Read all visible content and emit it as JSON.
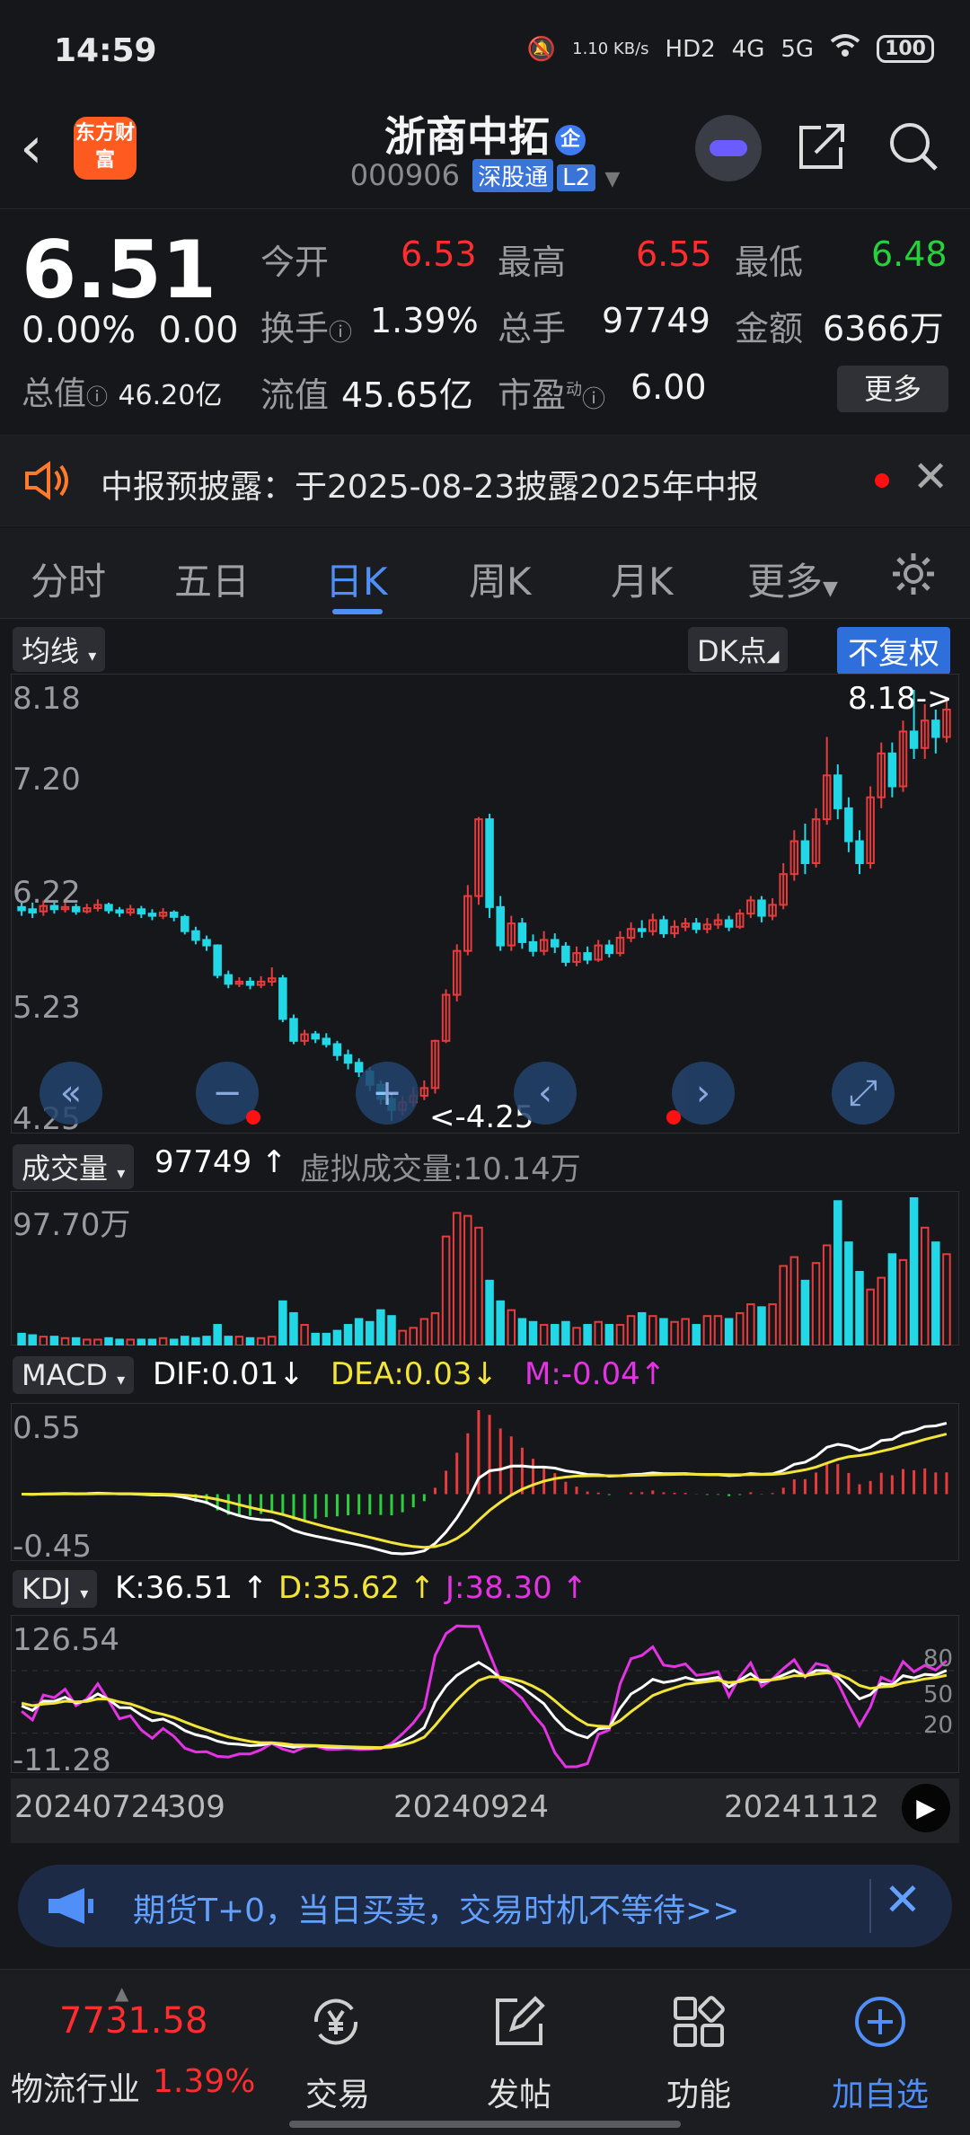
{
  "status": {
    "time": "14:59",
    "net_speed": "1.10 KB/s",
    "signal_a": "4G",
    "signal_b": "5G",
    "battery": "100",
    "hd": "HD2"
  },
  "header": {
    "logo": "东方财富",
    "stock_name": "浙商中拓",
    "qi_badge": "企",
    "code": "000906",
    "tag_sgt": "深股通",
    "tag_l2": "L2"
  },
  "quote": {
    "price": "6.51",
    "change_pct": "0.00%",
    "change": "0.00",
    "open_label": "今开",
    "open": "6.53",
    "high_label": "最高",
    "high": "6.55",
    "low_label": "最低",
    "low": "6.48",
    "turnover_label": "换手",
    "turnover": "1.39%",
    "volume_label": "总手",
    "volume": "97749",
    "amount_label": "金额",
    "amount": "6366万",
    "mktcap_label": "总值",
    "mktcap": "46.20亿",
    "float_label": "流值",
    "float": "45.65亿",
    "pe_label": "市盈",
    "pe_sup": "动",
    "pe": "6.00",
    "more": "更多"
  },
  "notice": {
    "text": "中报预披露：于2025-08-23披露2025年中报"
  },
  "tabs": [
    "分时",
    "五日",
    "日K",
    "周K",
    "月K",
    "更多"
  ],
  "chart_controls": {
    "ma": "均线",
    "dk": "DK点",
    "fq": "不复权"
  },
  "chart_data": [
    {
      "type": "candlestick",
      "y_ticks": [
        "8.18",
        "7.20",
        "6.22",
        "5.23",
        "4.25"
      ],
      "ylim": [
        4.25,
        8.18
      ],
      "max_label": "8.18->",
      "min_label": "<-4.25",
      "candles": [
        [
          6.2,
          6.17,
          6.25,
          6.12
        ],
        [
          6.18,
          6.15,
          6.24,
          6.1
        ],
        [
          6.16,
          6.21,
          6.26,
          6.12
        ],
        [
          6.21,
          6.18,
          6.25,
          6.14
        ],
        [
          6.18,
          6.2,
          6.24,
          6.15
        ],
        [
          6.2,
          6.16,
          6.23,
          6.13
        ],
        [
          6.16,
          6.19,
          6.23,
          6.14
        ],
        [
          6.19,
          6.22,
          6.27,
          6.16
        ],
        [
          6.22,
          6.17,
          6.24,
          6.14
        ],
        [
          6.17,
          6.15,
          6.2,
          6.11
        ],
        [
          6.15,
          6.18,
          6.22,
          6.12
        ],
        [
          6.18,
          6.14,
          6.21,
          6.1
        ],
        [
          6.14,
          6.12,
          6.18,
          6.08
        ],
        [
          6.12,
          6.15,
          6.19,
          6.09
        ],
        [
          6.15,
          6.11,
          6.17,
          6.07
        ],
        [
          6.11,
          5.98,
          6.13,
          5.95
        ],
        [
          5.98,
          5.9,
          6.02,
          5.86
        ],
        [
          5.9,
          5.85,
          5.94,
          5.8
        ],
        [
          5.85,
          5.58,
          5.86,
          5.55
        ],
        [
          5.58,
          5.5,
          5.62,
          5.46
        ],
        [
          5.5,
          5.52,
          5.56,
          5.47
        ],
        [
          5.52,
          5.49,
          5.56,
          5.45
        ],
        [
          5.49,
          5.52,
          5.57,
          5.46
        ],
        [
          5.52,
          5.55,
          5.65,
          5.48
        ],
        [
          5.55,
          5.18,
          5.58,
          5.15
        ],
        [
          5.18,
          4.98,
          5.22,
          4.95
        ],
        [
          4.98,
          5.04,
          5.08,
          4.94
        ],
        [
          5.04,
          5.0,
          5.07,
          4.96
        ],
        [
          5.0,
          4.95,
          5.05,
          4.92
        ],
        [
          4.95,
          4.85,
          4.98,
          4.8
        ],
        [
          4.85,
          4.78,
          4.9,
          4.72
        ],
        [
          4.78,
          4.7,
          4.82,
          4.65
        ],
        [
          4.7,
          4.58,
          4.74,
          4.52
        ],
        [
          4.58,
          4.45,
          4.62,
          4.4
        ],
        [
          4.45,
          4.35,
          4.5,
          4.25
        ],
        [
          4.35,
          4.42,
          4.48,
          4.3
        ],
        [
          4.42,
          4.48,
          4.56,
          4.38
        ],
        [
          4.48,
          4.55,
          4.62,
          4.44
        ],
        [
          4.55,
          4.98,
          4.99,
          4.5
        ],
        [
          4.98,
          5.4,
          5.45,
          4.96
        ],
        [
          5.4,
          5.8,
          5.86,
          5.34
        ],
        [
          5.8,
          6.3,
          6.4,
          5.76
        ],
        [
          6.3,
          7.0,
          7.02,
          6.22
        ],
        [
          7.0,
          6.2,
          7.05,
          6.1
        ],
        [
          6.2,
          5.85,
          6.3,
          5.8
        ],
        [
          5.85,
          6.05,
          6.12,
          5.8
        ],
        [
          6.05,
          5.88,
          6.1,
          5.82
        ],
        [
          5.88,
          5.8,
          5.95,
          5.75
        ],
        [
          5.8,
          5.9,
          5.98,
          5.76
        ],
        [
          5.9,
          5.84,
          5.96,
          5.78
        ],
        [
          5.84,
          5.7,
          5.88,
          5.66
        ],
        [
          5.7,
          5.78,
          5.84,
          5.66
        ],
        [
          5.78,
          5.72,
          5.84,
          5.68
        ],
        [
          5.72,
          5.85,
          5.9,
          5.7
        ],
        [
          5.85,
          5.78,
          5.9,
          5.74
        ],
        [
          5.78,
          5.92,
          5.98,
          5.75
        ],
        [
          5.92,
          6.0,
          6.06,
          5.88
        ],
        [
          6.0,
          5.98,
          6.08,
          5.92
        ],
        [
          5.98,
          6.08,
          6.14,
          5.94
        ],
        [
          6.08,
          5.96,
          6.12,
          5.92
        ],
        [
          5.96,
          6.02,
          6.08,
          5.92
        ],
        [
          6.02,
          6.05,
          6.1,
          5.98
        ],
        [
          6.05,
          6.0,
          6.1,
          5.96
        ],
        [
          6.0,
          6.04,
          6.1,
          5.96
        ],
        [
          6.04,
          6.08,
          6.14,
          6.0
        ],
        [
          6.08,
          6.02,
          6.12,
          5.98
        ],
        [
          6.02,
          6.14,
          6.18,
          6.0
        ],
        [
          6.14,
          6.26,
          6.3,
          6.1
        ],
        [
          6.26,
          6.12,
          6.3,
          6.06
        ],
        [
          6.12,
          6.22,
          6.28,
          6.08
        ],
        [
          6.22,
          6.5,
          6.6,
          6.18
        ],
        [
          6.5,
          6.8,
          6.9,
          6.44
        ],
        [
          6.8,
          6.6,
          6.96,
          6.5
        ],
        [
          6.6,
          7.0,
          7.1,
          6.56
        ],
        [
          7.0,
          7.4,
          7.75,
          6.95
        ],
        [
          7.4,
          7.1,
          7.5,
          7.0
        ],
        [
          7.1,
          6.8,
          7.2,
          6.7
        ],
        [
          6.8,
          6.6,
          6.9,
          6.5
        ],
        [
          6.6,
          7.2,
          7.3,
          6.55
        ],
        [
          7.2,
          7.6,
          7.7,
          7.1
        ],
        [
          7.6,
          7.3,
          7.7,
          7.2
        ],
        [
          7.3,
          7.8,
          7.9,
          7.25
        ],
        [
          7.8,
          7.65,
          8.18,
          7.55
        ],
        [
          7.65,
          7.9,
          8.05,
          7.55
        ],
        [
          7.9,
          7.75,
          8.0,
          7.6
        ],
        [
          7.75,
          8.0,
          8.1,
          7.7
        ]
      ],
      "volume_label": "成交量",
      "volume_value": "97749",
      "virtual_volume": "虚拟成交量:10.14万",
      "volume_max": "97.70万",
      "volumes": [
        8,
        7,
        6,
        6,
        5,
        5,
        4,
        4,
        5,
        4,
        4,
        4,
        4,
        5,
        4,
        6,
        5,
        6,
        14,
        6,
        6,
        5,
        5,
        6,
        30,
        22,
        14,
        8,
        8,
        10,
        14,
        18,
        16,
        24,
        20,
        10,
        12,
        18,
        22,
        74,
        90,
        88,
        80,
        44,
        30,
        24,
        18,
        16,
        14,
        14,
        16,
        12,
        14,
        16,
        14,
        14,
        20,
        22,
        20,
        18,
        16,
        18,
        14,
        20,
        20,
        18,
        22,
        28,
        26,
        28,
        54,
        60,
        44,
        56,
        68,
        98,
        70,
        50,
        38,
        46,
        62,
        58,
        100,
        80,
        70,
        62
      ],
      "macd_label": "MACD",
      "dif": "DIF:0.01",
      "dea": "DEA:0.03",
      "m": "M:-0.04",
      "macd_ticks": [
        "0.55",
        "-0.45"
      ],
      "kdj_label": "KDJ",
      "k": "K:36.51",
      "d": "D:35.62",
      "j": "J:38.30",
      "kdj_ticks": [
        "126.54",
        "-11.28"
      ],
      "kdj_levels": [
        "80",
        "50",
        "20"
      ],
      "dates": [
        "20240724",
        "309",
        "20240924",
        "20241112"
      ]
    }
  ],
  "banner": {
    "text": "期货T+0，当日买卖，交易时机不等待>>"
  },
  "bottom": {
    "index_value": "7731.58",
    "index_name": "物流行业",
    "index_change": "1.39%",
    "trade": "交易",
    "post": "发帖",
    "func": "功能",
    "add": "加自选"
  }
}
